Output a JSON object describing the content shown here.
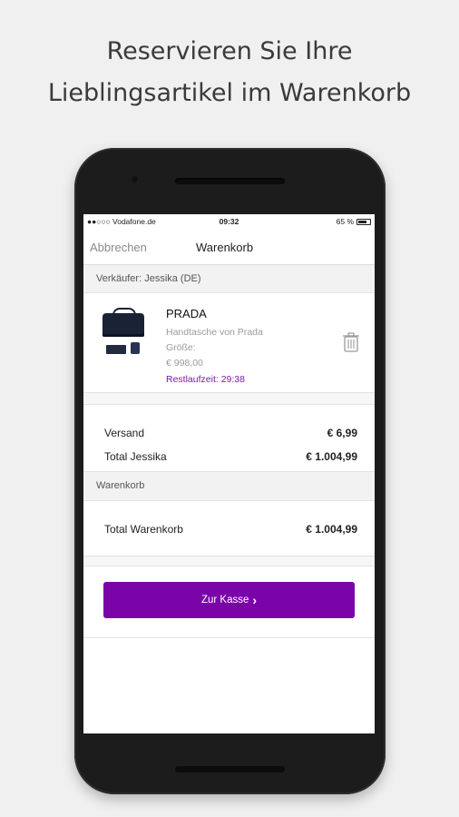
{
  "headline": {
    "line1": "Reservieren Sie Ihre",
    "line2": "Lieblingsartikel im Warenkorb"
  },
  "statusbar": {
    "carrier": "●●○○○ Vodafone.de",
    "time": "09:32",
    "battery": "65 %"
  },
  "navbar": {
    "cancel_label": "Abbrechen",
    "title": "Warenkorb"
  },
  "seller_section": {
    "label": "Verkäufer: Jessika (DE)"
  },
  "item": {
    "brand": "PRADA",
    "description": "Handtasche von Prada",
    "size": "Größe:",
    "price": "€ 998,00",
    "timer": "Restlaufzeit: 29:38"
  },
  "seller_summary": {
    "shipping_label": "Versand",
    "shipping_value": "€ 6,99",
    "total_label": "Total Jessika",
    "total_value": "€ 1.004,99"
  },
  "cart_section": {
    "label": "Warenkorb"
  },
  "cart_total": {
    "label": "Total Warenkorb",
    "value": "€ 1.004,99"
  },
  "checkout": {
    "label": "Zur Kasse",
    "chevron": "›"
  },
  "colors": {
    "accent": "#7a04a8",
    "timer": "#7a1ca3"
  }
}
